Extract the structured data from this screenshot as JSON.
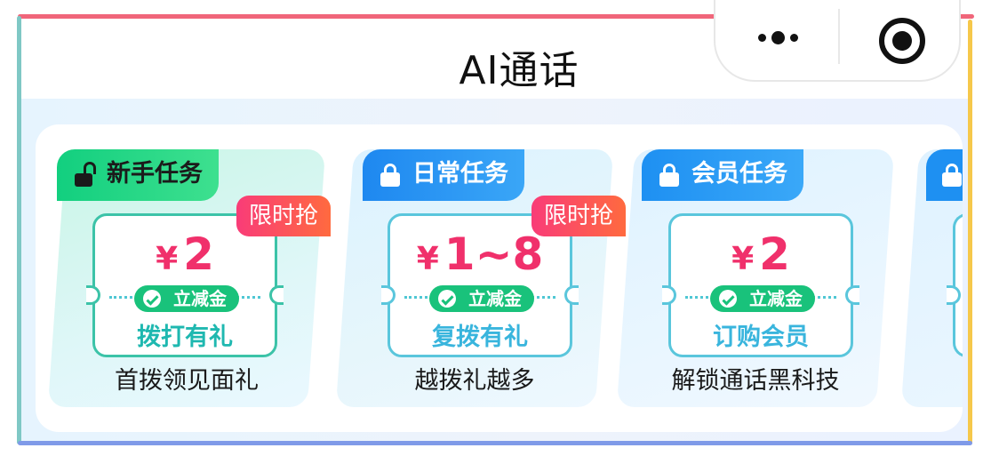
{
  "nav": {
    "title": "AI通话"
  },
  "colors": {
    "newbie_tag": "#17cf7a",
    "daily_tag": "#2b8ff2",
    "member_tag": "#2b93f2",
    "badge": "#f93c78",
    "price": "#f0306b",
    "pill": "#19c27b"
  },
  "tasks": [
    {
      "tag": "新手任务",
      "tag_icon": "unlock-icon",
      "badge": "限时抢",
      "currency": "¥",
      "amount": "2",
      "pill": "立减金",
      "label": "拨打有礼",
      "desc": "首拨领见面礼"
    },
    {
      "tag": "日常任务",
      "tag_icon": "lock-icon",
      "badge": "限时抢",
      "currency": "¥",
      "amount": "1~8",
      "pill": "立减金",
      "label": "复拨有礼",
      "desc": "越拨礼越多"
    },
    {
      "tag": "会员任务",
      "tag_icon": "lock-icon",
      "currency": "¥",
      "amount": "2",
      "pill": "立减金",
      "label": "订购会员",
      "desc": "解锁通话黑科技"
    }
  ]
}
